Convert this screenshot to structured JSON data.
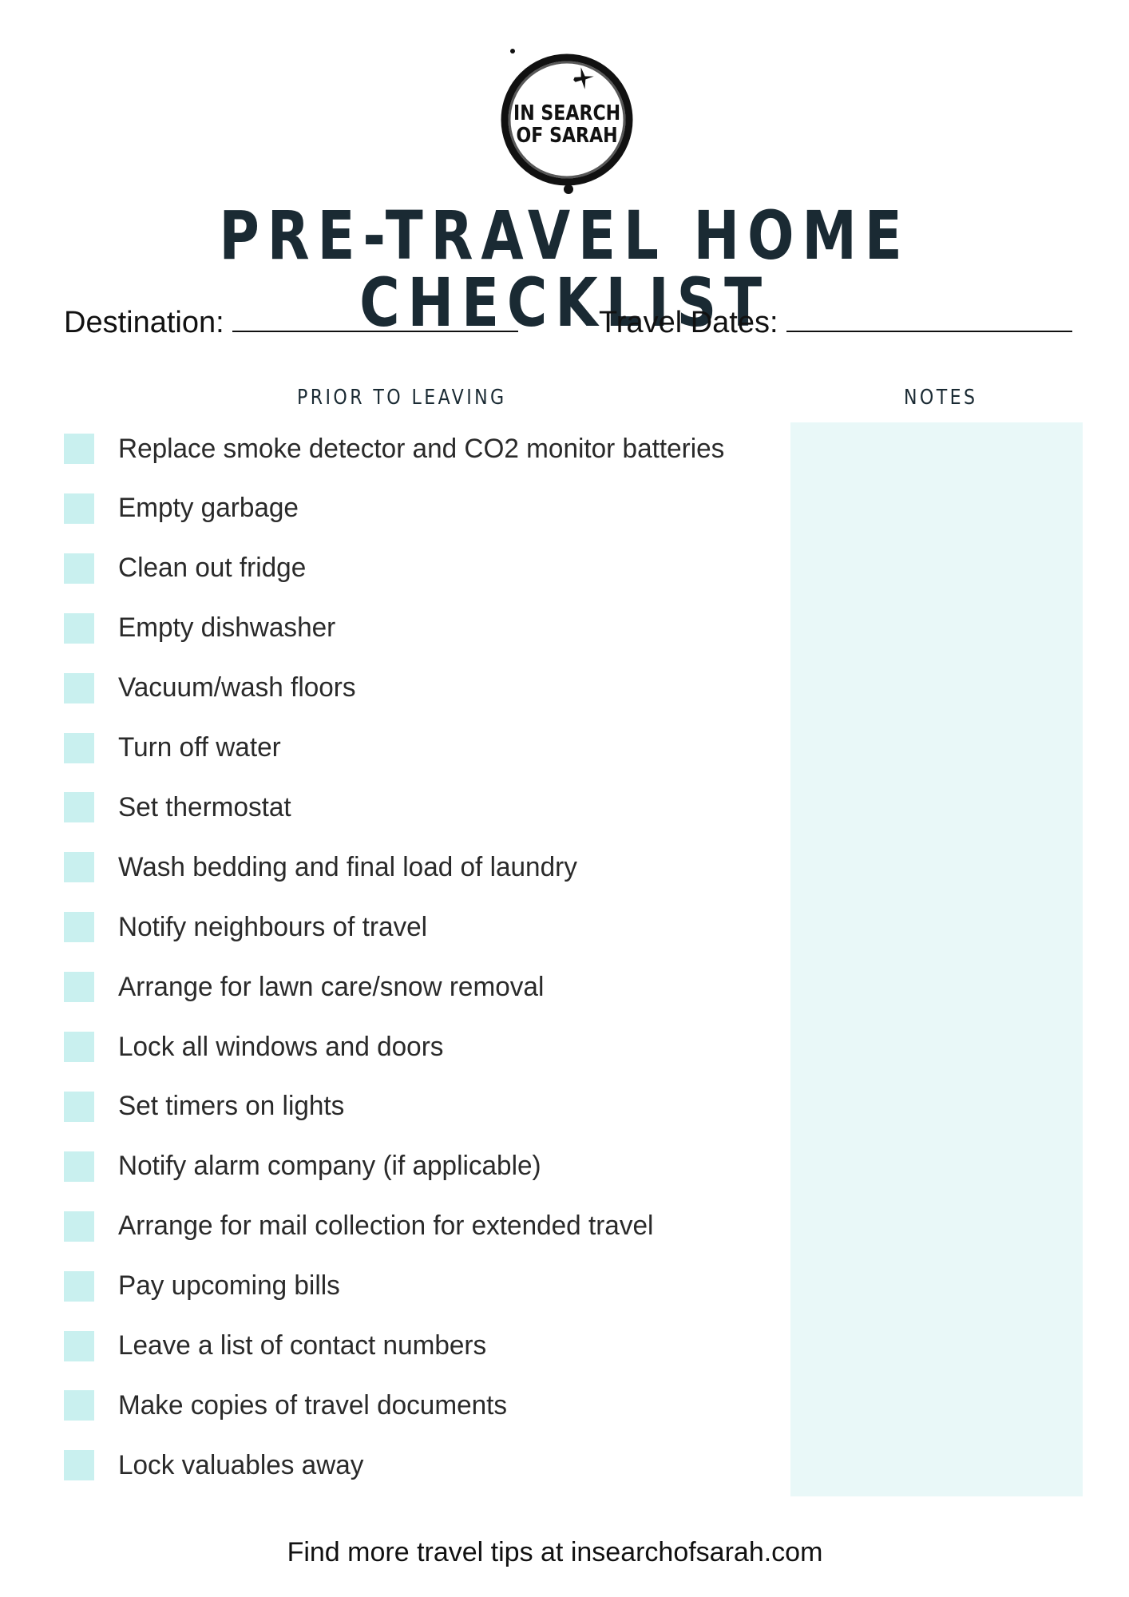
{
  "logo": {
    "line1": "IN SEARCH",
    "line2": "OF SARAH",
    "icon": "airplane-icon"
  },
  "title": "PRE-TRAVEL HOME CHECKLIST",
  "fields": {
    "destination_label": "Destination:",
    "destination_value": "",
    "travel_dates_label": "Travel Dates:",
    "travel_dates_value": ""
  },
  "columns": {
    "prior": "PRIOR TO LEAVING",
    "notes": "NOTES"
  },
  "items": [
    {
      "label": "Replace smoke detector and CO2 monitor batteries",
      "checked": false
    },
    {
      "label": "Empty garbage",
      "checked": false
    },
    {
      "label": "Clean out fridge",
      "checked": false
    },
    {
      "label": "Empty dishwasher",
      "checked": false
    },
    {
      "label": "Vacuum/wash floors",
      "checked": false
    },
    {
      "label": "Turn off water",
      "checked": false
    },
    {
      "label": "Set thermostat",
      "checked": false
    },
    {
      "label": "Wash bedding and final load of laundry",
      "checked": false
    },
    {
      "label": "Notify neighbours of travel",
      "checked": false
    },
    {
      "label": "Arrange for lawn care/snow removal",
      "checked": false
    },
    {
      "label": "Lock all windows and doors",
      "checked": false
    },
    {
      "label": "Set timers on lights",
      "checked": false
    },
    {
      "label": "Notify alarm company (if applicable)",
      "checked": false
    },
    {
      "label": "Arrange for mail collection for extended travel",
      "checked": false
    },
    {
      "label": "Pay upcoming bills",
      "checked": false
    },
    {
      "label": "Leave a list of contact numbers",
      "checked": false
    },
    {
      "label": "Make copies of travel documents",
      "checked": false
    },
    {
      "label": "Lock valuables away",
      "checked": false
    }
  ],
  "footer": "Find more travel tips at insearchofsarah.com",
  "colors": {
    "checkbox": "#c9f0ef",
    "notes_bg": "#e9f8f8",
    "title": "#1a2a33"
  }
}
